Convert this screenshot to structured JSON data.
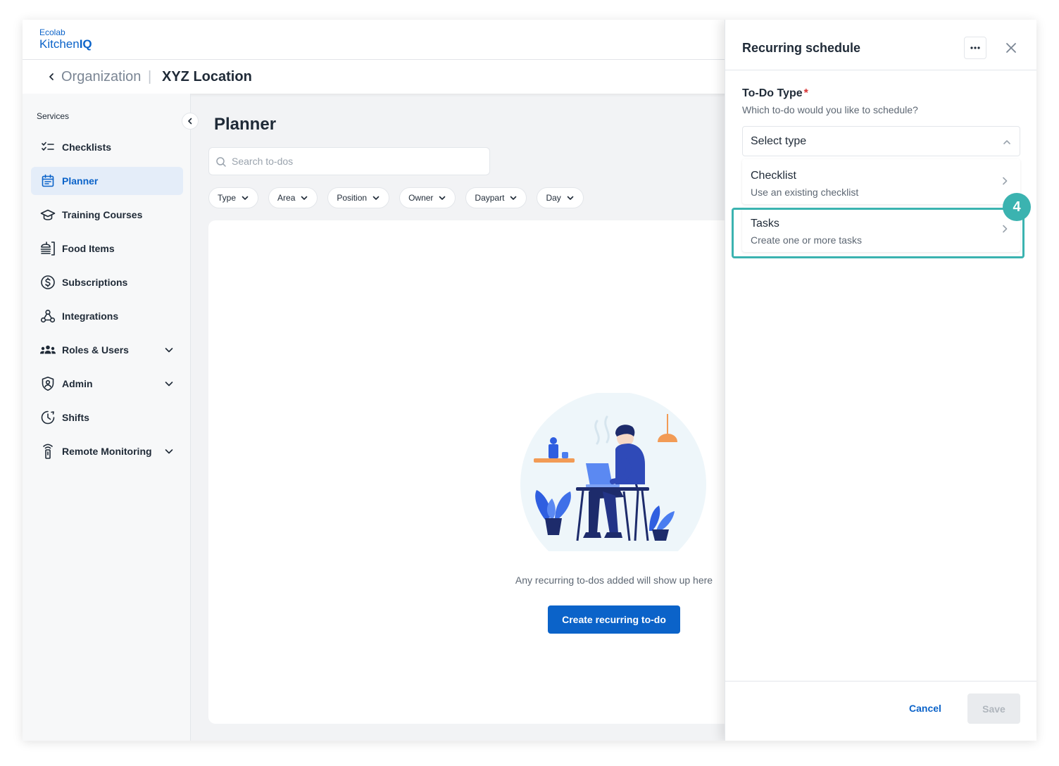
{
  "brand": {
    "line1": "Ecolab",
    "line2_prefix": "Kitchen",
    "line2_bold": "IQ"
  },
  "breadcrumb": {
    "organization": "Organization",
    "separator": "|",
    "location": "XYZ Location"
  },
  "sidebar": {
    "title": "Services",
    "items": [
      {
        "label": "Checklists",
        "icon": "checklist-icon",
        "active": false
      },
      {
        "label": "Planner",
        "icon": "calendar-icon",
        "active": true
      },
      {
        "label": "Training Courses",
        "icon": "graduation-cap-icon",
        "active": false
      },
      {
        "label": "Food Items",
        "icon": "food-items-icon",
        "active": false
      },
      {
        "label": "Subscriptions",
        "icon": "dollar-circle-icon",
        "active": false
      },
      {
        "label": "Integrations",
        "icon": "webhook-icon",
        "active": false
      },
      {
        "label": "Roles & Users",
        "icon": "users-icon",
        "active": false,
        "expandable": true
      },
      {
        "label": "Admin",
        "icon": "shield-icon",
        "active": false,
        "expandable": true
      },
      {
        "label": "Shifts",
        "icon": "clock-icon",
        "active": false
      },
      {
        "label": "Remote Monitoring",
        "icon": "sensor-icon",
        "active": false,
        "expandable": true
      }
    ]
  },
  "main": {
    "title": "Planner",
    "search": {
      "placeholder": "Search to-dos",
      "value": ""
    },
    "filters": [
      "Type",
      "Area",
      "Position",
      "Owner",
      "Daypart",
      "Day"
    ],
    "empty_text": "Any recurring to-dos added will show up here",
    "create_label": "Create recurring to-do"
  },
  "panel": {
    "title": "Recurring schedule",
    "more_label": "•••",
    "field_label": "To-Do Type",
    "required_mark": "*",
    "field_help": "Which to-do would you like to schedule?",
    "select_value": "Select type",
    "options": [
      {
        "title": "Checklist",
        "subtitle": "Use an existing checklist"
      },
      {
        "title": "Tasks",
        "subtitle": "Create one or more tasks"
      }
    ],
    "step_badge": "4",
    "cancel_label": "Cancel",
    "save_label": "Save"
  },
  "colors": {
    "primary": "#0b63c9",
    "highlight": "#3bb3b0",
    "active_bg": "#e4edf9",
    "required": "#d63232"
  }
}
